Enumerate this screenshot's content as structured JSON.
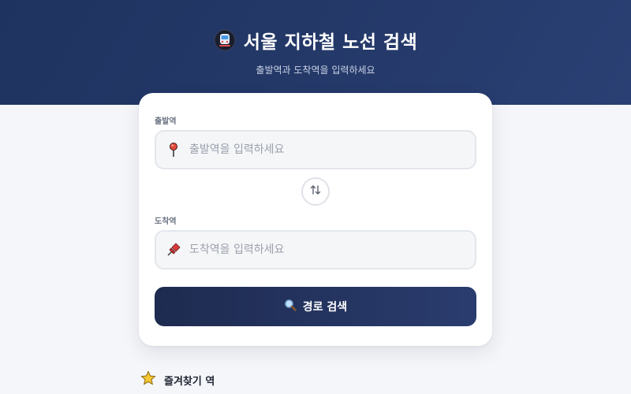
{
  "header": {
    "title": "서울 지하철 노선 검색",
    "subtitle": "출발역과 도착역을 입력하세요",
    "icon": "train-icon"
  },
  "form": {
    "origin": {
      "label": "출발역",
      "placeholder": "출발역을 입력하세요",
      "value": "",
      "icon": "pin-icon"
    },
    "swap_icon": "swap-arrows-icon",
    "destination": {
      "label": "도착역",
      "placeholder": "도착역을 입력하세요",
      "value": "",
      "icon": "pushpin-icon"
    },
    "search_button": {
      "label": "경로 검색",
      "icon": "search-icon"
    }
  },
  "favorites": {
    "title": "즐겨찾기 역",
    "icon": "star-icon"
  },
  "colors": {
    "header_bg": "#253a6a",
    "button_bg": "#1e2b50",
    "page_bg": "#f5f6f9"
  }
}
